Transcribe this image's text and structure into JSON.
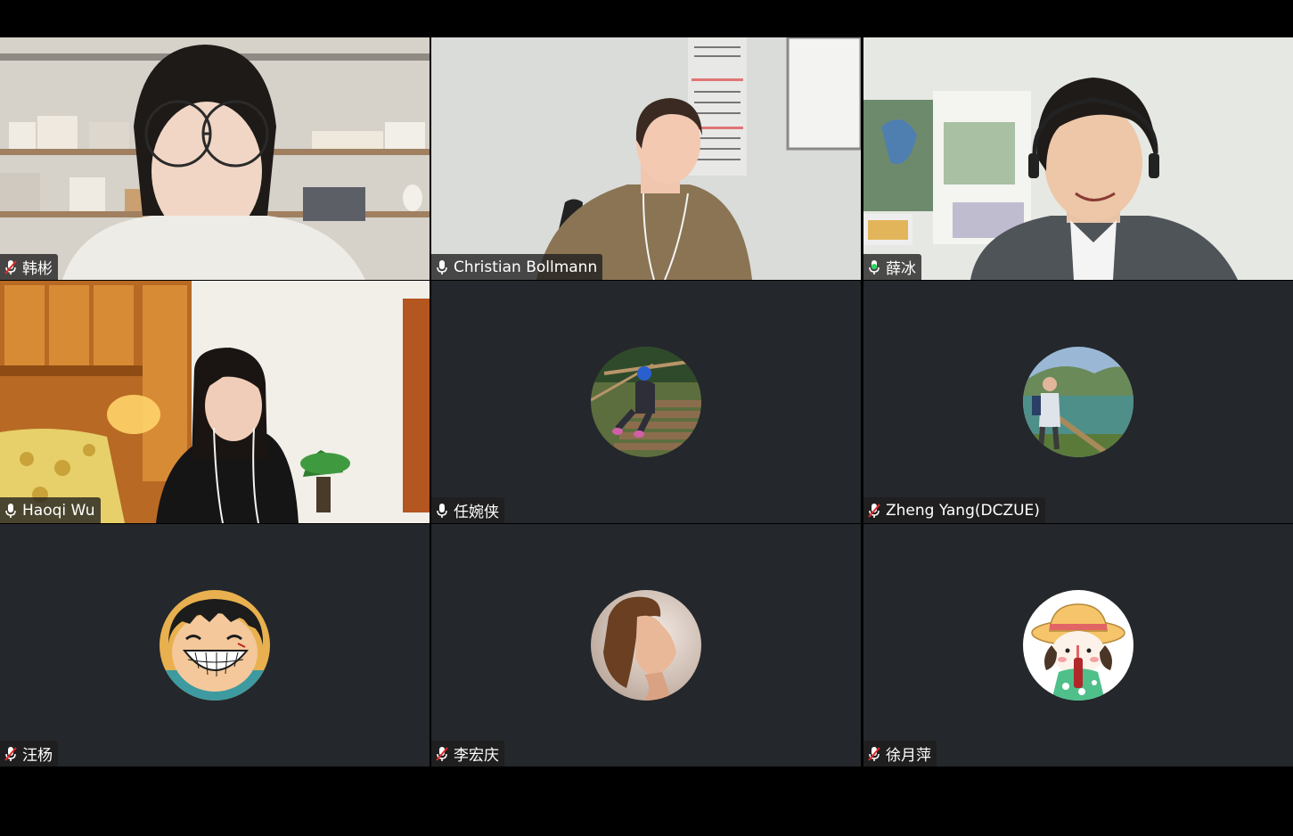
{
  "meeting": {
    "participants": [
      {
        "name": "韩彬",
        "mic": "muted",
        "view": "video"
      },
      {
        "name": "Christian Bollmann",
        "mic": "unmuted",
        "view": "video"
      },
      {
        "name": "薛冰",
        "mic": "speaking",
        "view": "video",
        "active_speaker": true
      },
      {
        "name": "Haoqi Wu",
        "mic": "unmuted",
        "view": "video"
      },
      {
        "name": "任婉侠",
        "mic": "unmuted",
        "view": "avatar"
      },
      {
        "name": "Zheng Yang(DCZUE)",
        "mic": "muted",
        "view": "avatar"
      },
      {
        "name": "汪杨",
        "mic": "muted",
        "view": "avatar"
      },
      {
        "name": "李宏庆",
        "mic": "muted",
        "view": "avatar"
      },
      {
        "name": "徐月萍",
        "mic": "muted",
        "view": "avatar"
      }
    ]
  },
  "colors": {
    "tile_background": "#24272b",
    "active_speaker_border": "#23d959",
    "muted_icon": "#e02828",
    "speaking_icon": "#23d959",
    "name_tag_text": "#ffffff"
  }
}
